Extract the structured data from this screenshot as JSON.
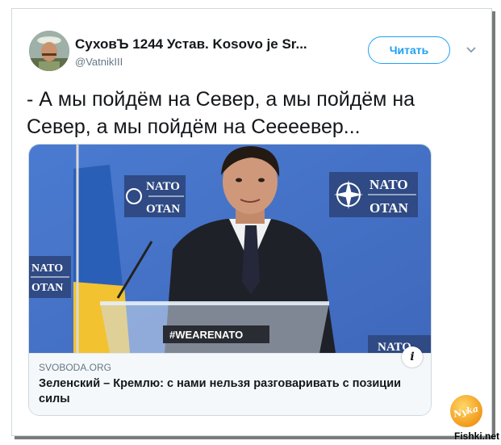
{
  "tweet": {
    "author_name": "СуховЪ 1244 Устав. Kosovo je Sr...",
    "author_handle": "@VatnikIII",
    "follow_label": "Читать",
    "text": "- А мы пойдём на Север, а мы пойдём на Север, а мы пойдём на Сеееевер..."
  },
  "card": {
    "domain": "SVOBODA.ORG",
    "title": "Зеленский – Кремлю: с нами нельзя разговаривать с позиции силы",
    "image": {
      "sign_text": "NATO",
      "sign_text_2": "OTAN",
      "podium_text": "#WEARENATO"
    }
  },
  "watermark": {
    "logo_text": "Nyka",
    "site": "Fishki.net"
  },
  "colors": {
    "accent": "#1da1f2",
    "background_blue": "#4f7fd4",
    "nato_blue": "#2f4a84"
  },
  "icons": {
    "caret": "chevron-down-icon",
    "info": "info-icon"
  }
}
